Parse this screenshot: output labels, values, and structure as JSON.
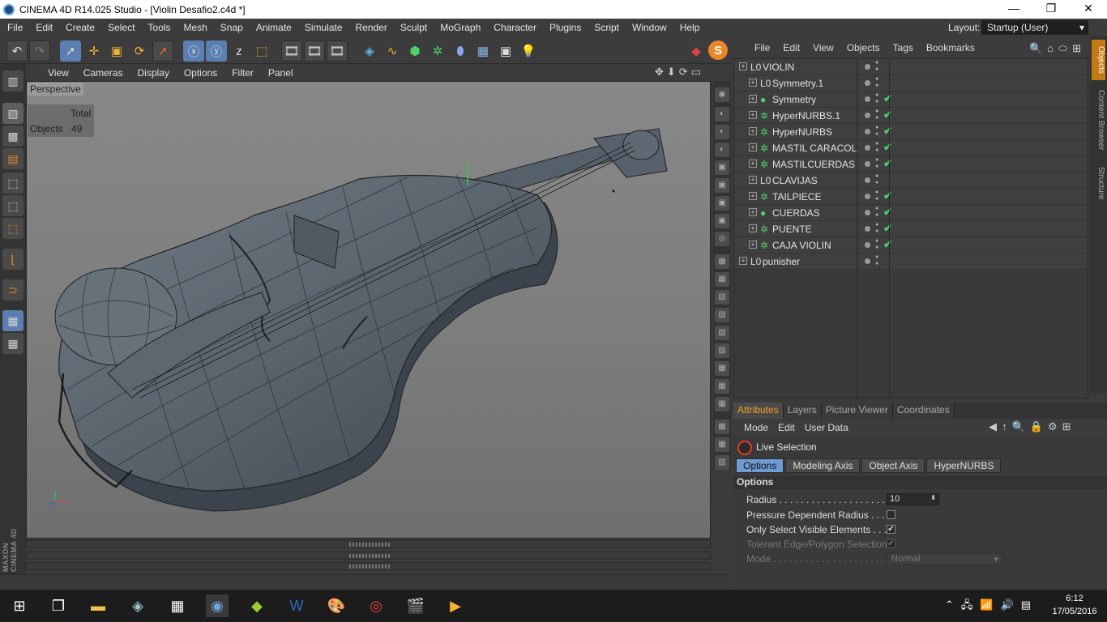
{
  "window": {
    "title": "CINEMA 4D R14.025 Studio - [Violin Desafio2.c4d *]",
    "minimize_icon": "minimize-icon",
    "maximize_icon": "restore-icon",
    "close_icon": "close-icon"
  },
  "menubar": [
    "File",
    "Edit",
    "Create",
    "Select",
    "Tools",
    "Mesh",
    "Snap",
    "Animate",
    "Simulate",
    "Render",
    "Sculpt",
    "MoGraph",
    "Character",
    "Plugins",
    "Script",
    "Window",
    "Help"
  ],
  "layout": {
    "label": "Layout:",
    "value": "Startup (User)"
  },
  "viewport": {
    "menu": [
      "View",
      "Cameras",
      "Display",
      "Options",
      "Filter",
      "Panel"
    ],
    "label": "Perspective",
    "hud_header": "Total",
    "hud_label": "Objects",
    "hud_value": "49"
  },
  "objects": {
    "menu": [
      "File",
      "Edit",
      "View",
      "Objects",
      "Tags",
      "Bookmarks"
    ],
    "items": [
      {
        "name": "VIOLIN",
        "icon": "null-icon",
        "indent": 0,
        "checked": false
      },
      {
        "name": "Symmetry.1",
        "icon": "null-icon",
        "indent": 1,
        "checked": false
      },
      {
        "name": "Symmetry",
        "icon": "symmetry-icon",
        "indent": 1,
        "checked": true
      },
      {
        "name": "HyperNURBS.1",
        "icon": "hypernurbs-icon",
        "indent": 1,
        "checked": true
      },
      {
        "name": "HyperNURBS",
        "icon": "hypernurbs-icon",
        "indent": 1,
        "checked": true
      },
      {
        "name": "MASTIL CARACOL",
        "icon": "hypernurbs-icon",
        "indent": 1,
        "checked": true
      },
      {
        "name": "MASTILCUERDAS",
        "icon": "hypernurbs-icon",
        "indent": 1,
        "checked": true
      },
      {
        "name": "CLAVIJAS",
        "icon": "null-icon",
        "indent": 1,
        "checked": false
      },
      {
        "name": "TAILPIECE",
        "icon": "hypernurbs-icon",
        "indent": 1,
        "checked": true
      },
      {
        "name": "CUERDAS",
        "icon": "symmetry-icon",
        "indent": 1,
        "checked": true
      },
      {
        "name": "PUENTE",
        "icon": "hypernurbs-icon",
        "indent": 1,
        "checked": true
      },
      {
        "name": "CAJA VIOLIN",
        "icon": "hypernurbs-icon",
        "indent": 1,
        "checked": true
      },
      {
        "name": "punisher",
        "icon": "null-icon",
        "indent": 0,
        "checked": false
      }
    ]
  },
  "sidetabs": [
    "Objects",
    "Content Browser",
    "Structure"
  ],
  "attributes": {
    "tabs": [
      "Attributes",
      "Layers",
      "Picture Viewer",
      "Coordinates"
    ],
    "menu": [
      "Mode",
      "Edit",
      "User Data"
    ],
    "tool_name": "Live Selection",
    "subtabs": [
      "Options",
      "Modeling Axis",
      "Object Axis",
      "HyperNURBS"
    ],
    "section": "Options",
    "radius_label": "Radius . . . . . . . . . . . . . . . . . . . .",
    "radius_value": "10",
    "pressure_label": "Pressure Dependent Radius . . . .",
    "pressure_checked": false,
    "visible_label": "Only Select Visible Elements . . . .",
    "visible_checked": true,
    "tolerant_label": "Tolerant Edge/Polygon Selection",
    "tolerant_checked": true,
    "mode_label": "Mode . . . . . . . . . . . . . . . . . . . . . .",
    "mode_value": "Normal"
  },
  "brand": "MAXON CINEMA 4D",
  "taskbar": {
    "time": "6:12",
    "date": "17/05/2016"
  },
  "colors": {
    "accent_orange": "#f0a020",
    "selection_blue": "#6f9bd3",
    "check_green": "#4fd36a"
  }
}
